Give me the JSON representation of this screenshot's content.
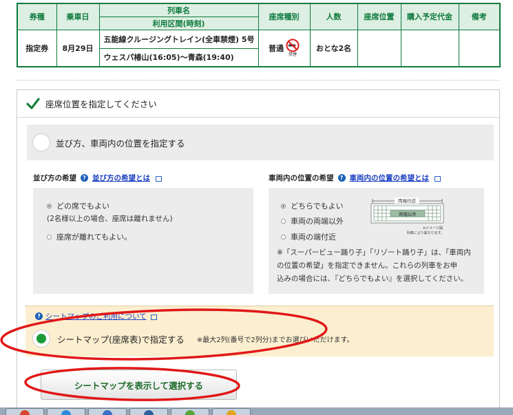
{
  "ticket": {
    "headers": {
      "ticket_type": "券種",
      "boarding_date": "乗車日",
      "train_name": "列車名",
      "section_time": "利用区間(時刻)",
      "seat_type": "座席種別",
      "people": "人数",
      "seat_position": "座席位置",
      "planned_fare": "購入予定代金",
      "remarks": "備考"
    },
    "row": {
      "ticket_type": "指定券",
      "boarding_date": "8月29日",
      "train_name": "五能線クルージングトレイン(全車禁煙) 5号",
      "section": "ウェスパ椿山(16:05)〜青森(19:40)",
      "seat_type": "普通",
      "no_smoking": "禁煙",
      "people": "おとな2名",
      "seat_position": "",
      "planned_fare": "",
      "remarks": ""
    }
  },
  "panel": {
    "title": "座席位置を指定してください",
    "option_arrangement": "並び方、車両内の位置を指定する",
    "arrangement": {
      "heading": "並び方の希望",
      "link": "並び方の希望とは",
      "options": [
        "どの席でもよい",
        "(2名様以上の場合、座席は離れません)",
        "座席が離れてもよい。"
      ]
    },
    "position": {
      "heading": "車両内の位置の希望",
      "link": "車両内の位置の希望とは",
      "options": [
        "どちらでもよい",
        "車両の両端以外",
        "車両の端付近"
      ],
      "diagram_top": "両端付近",
      "diagram_mid": "両端以外",
      "diagram_note1": "※イメージ図",
      "diagram_note2": "列車により異なります。",
      "note": [
        "※「スーパービュー踊り子」「リゾート踊り子」は、「車両内",
        "の位置の希望」を指定できません。これらの列車をお申",
        "込みの場合には、『どちらでもよい』を選択してください。"
      ]
    },
    "seatmap": {
      "link": "シートマップのご利用について",
      "option_label": "シートマップ(座席表)で指定する",
      "option_note": "※最大2列(番号で2列分)までお選びいただけます。",
      "button": "シートマップを表示して選択する"
    }
  },
  "colors": {
    "green": "#0e7a3c",
    "header_bg": "#dcefe2",
    "yellow_bg": "#fcefd0",
    "annotation_red": "#e01818",
    "link": "#1a3fc2"
  }
}
